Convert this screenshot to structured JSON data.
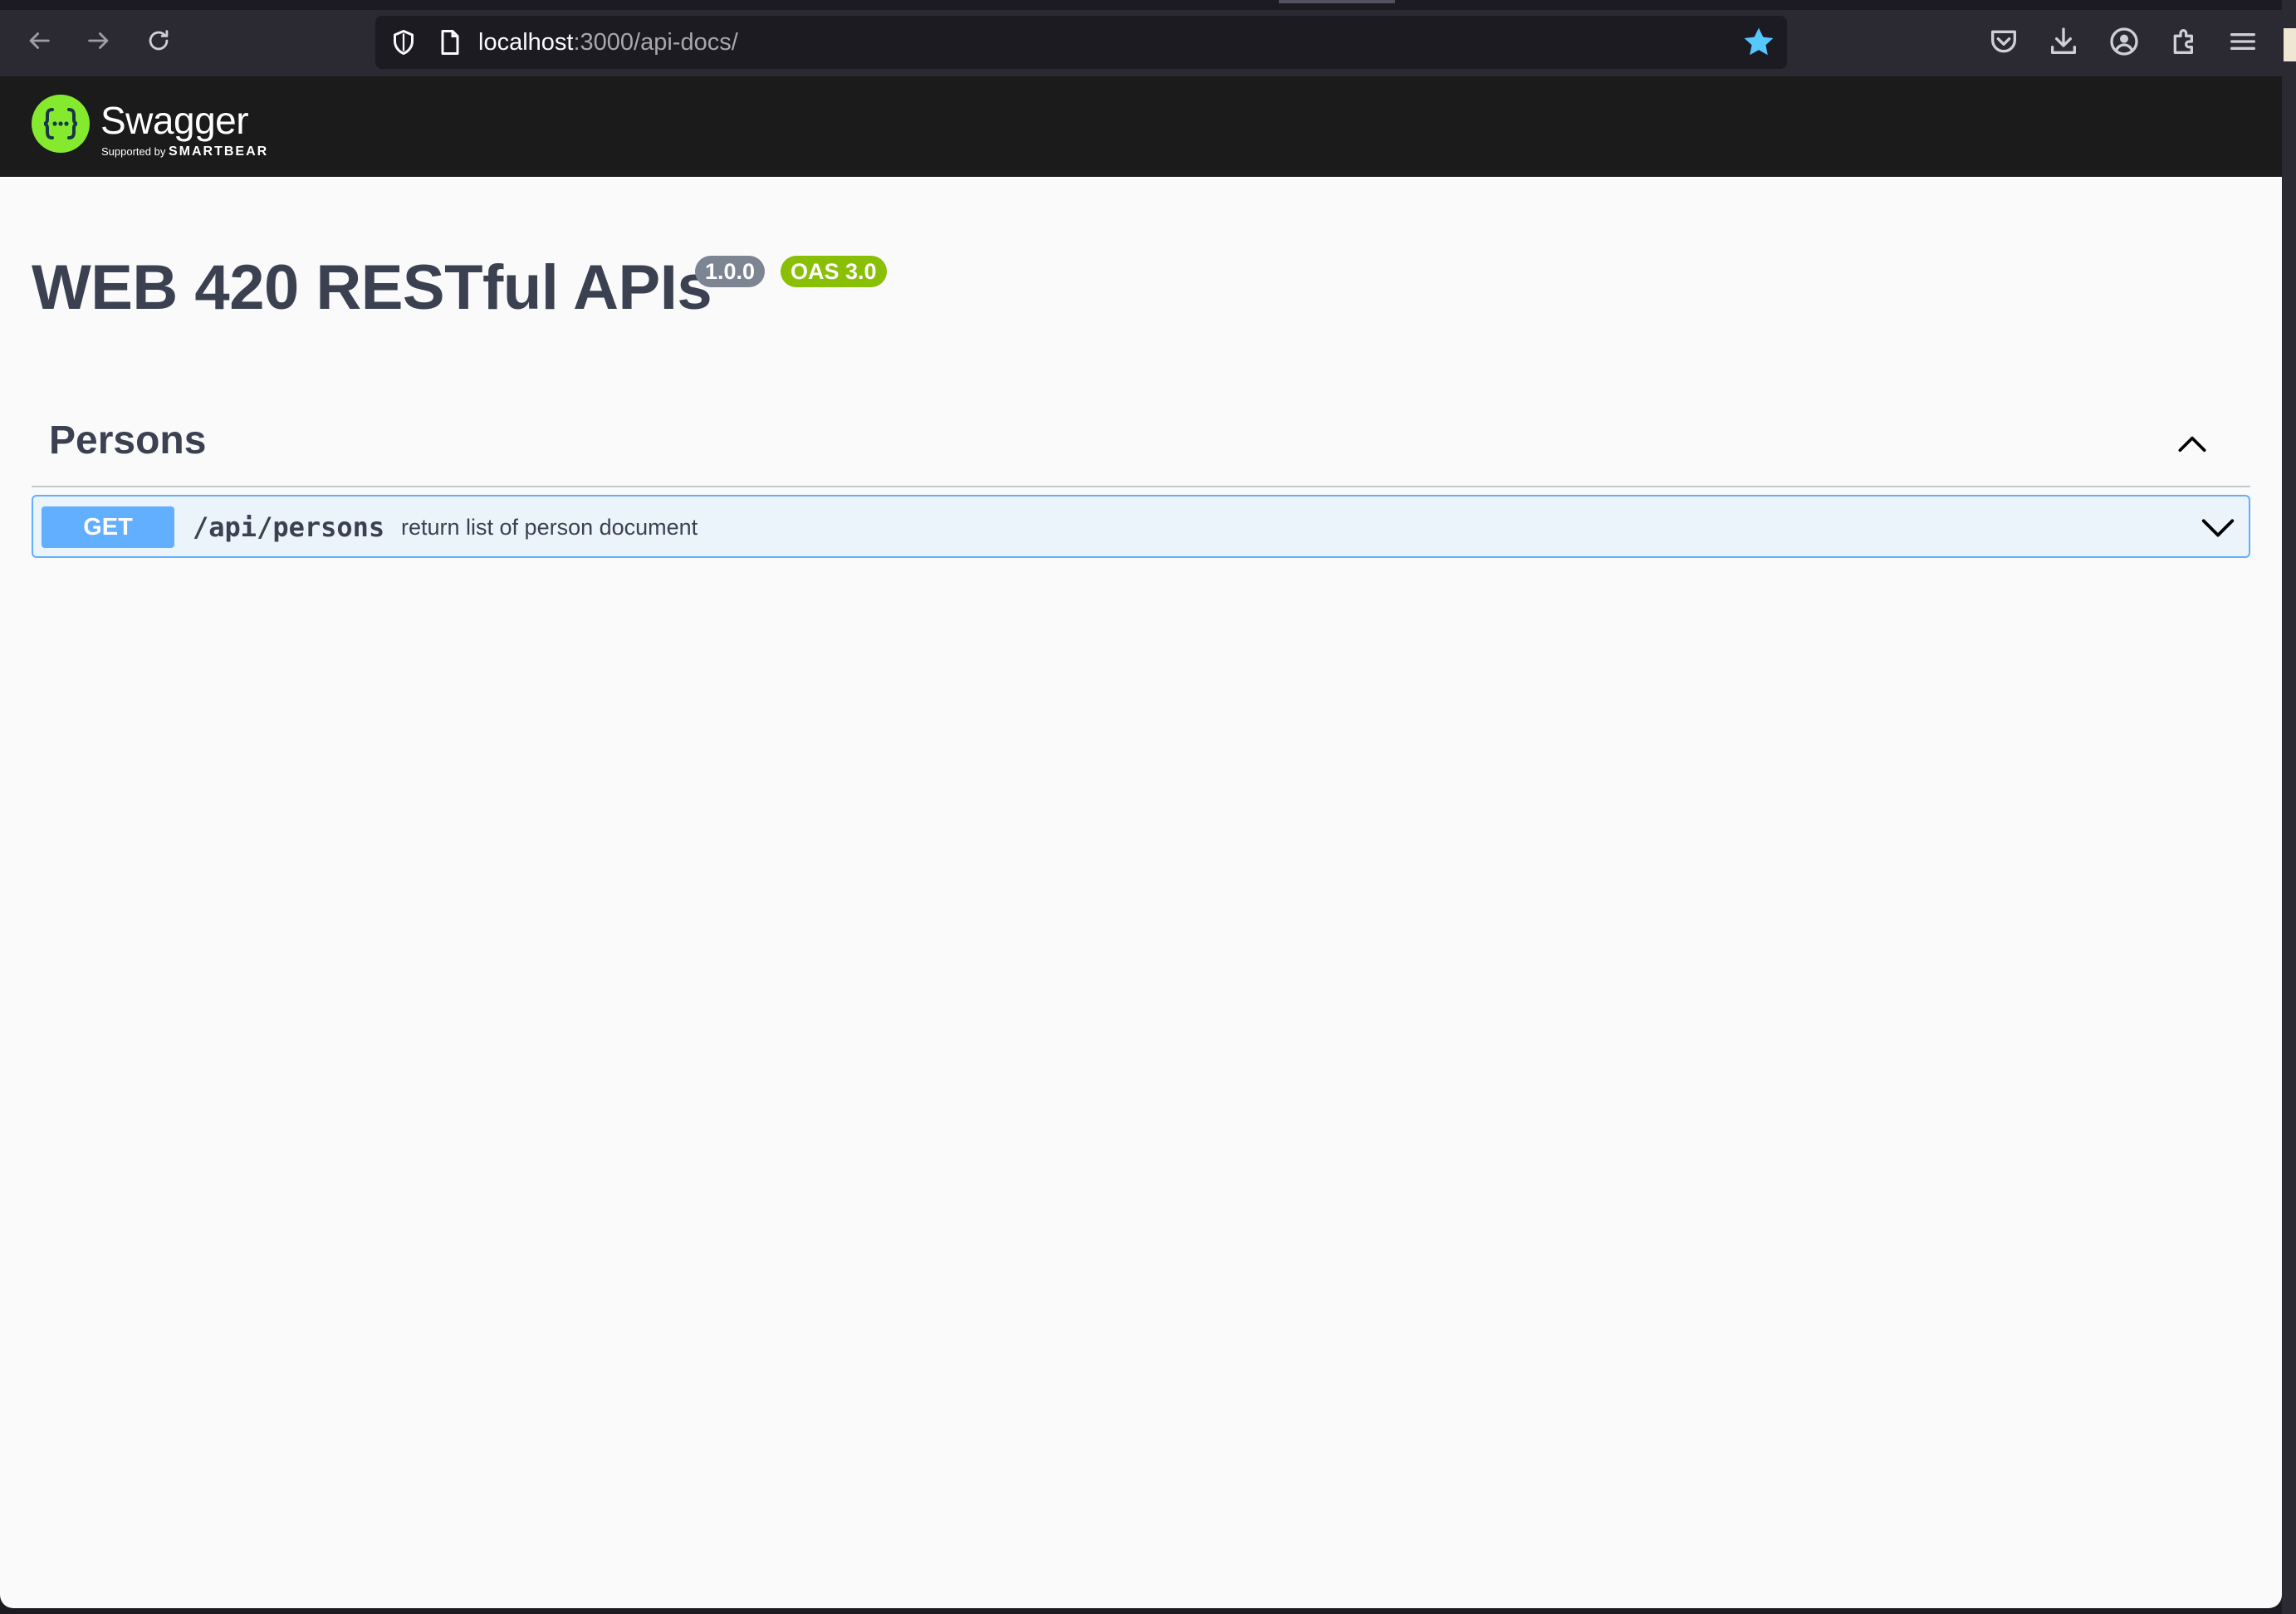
{
  "browser": {
    "url_host": "localhost",
    "url_rest": ":3000/api-docs/"
  },
  "swagger": {
    "logo_text": "Swagger",
    "supported_by": "Supported by",
    "smartbear": "SMARTBEAR"
  },
  "api": {
    "title": "WEB 420 RESTful APIs",
    "version_badge": "1.0.0",
    "oas_badge": "OAS 3.0"
  },
  "tag": {
    "name": "Persons",
    "operations": [
      {
        "method": "GET",
        "path": "/api/persons",
        "summary": "return list of person document"
      }
    ]
  },
  "colors": {
    "get_method": "#61affe",
    "oas_badge": "#89bf04",
    "swagger_green": "#85ea2d",
    "star": "#54c8ff"
  },
  "icons": [
    "back-arrow-icon",
    "forward-arrow-icon",
    "reload-icon",
    "shield-icon",
    "page-icon",
    "bookmark-star-icon",
    "pocket-icon",
    "download-icon",
    "account-icon",
    "extensions-icon",
    "menu-icon",
    "chevron-up-icon",
    "chevron-down-icon"
  ]
}
